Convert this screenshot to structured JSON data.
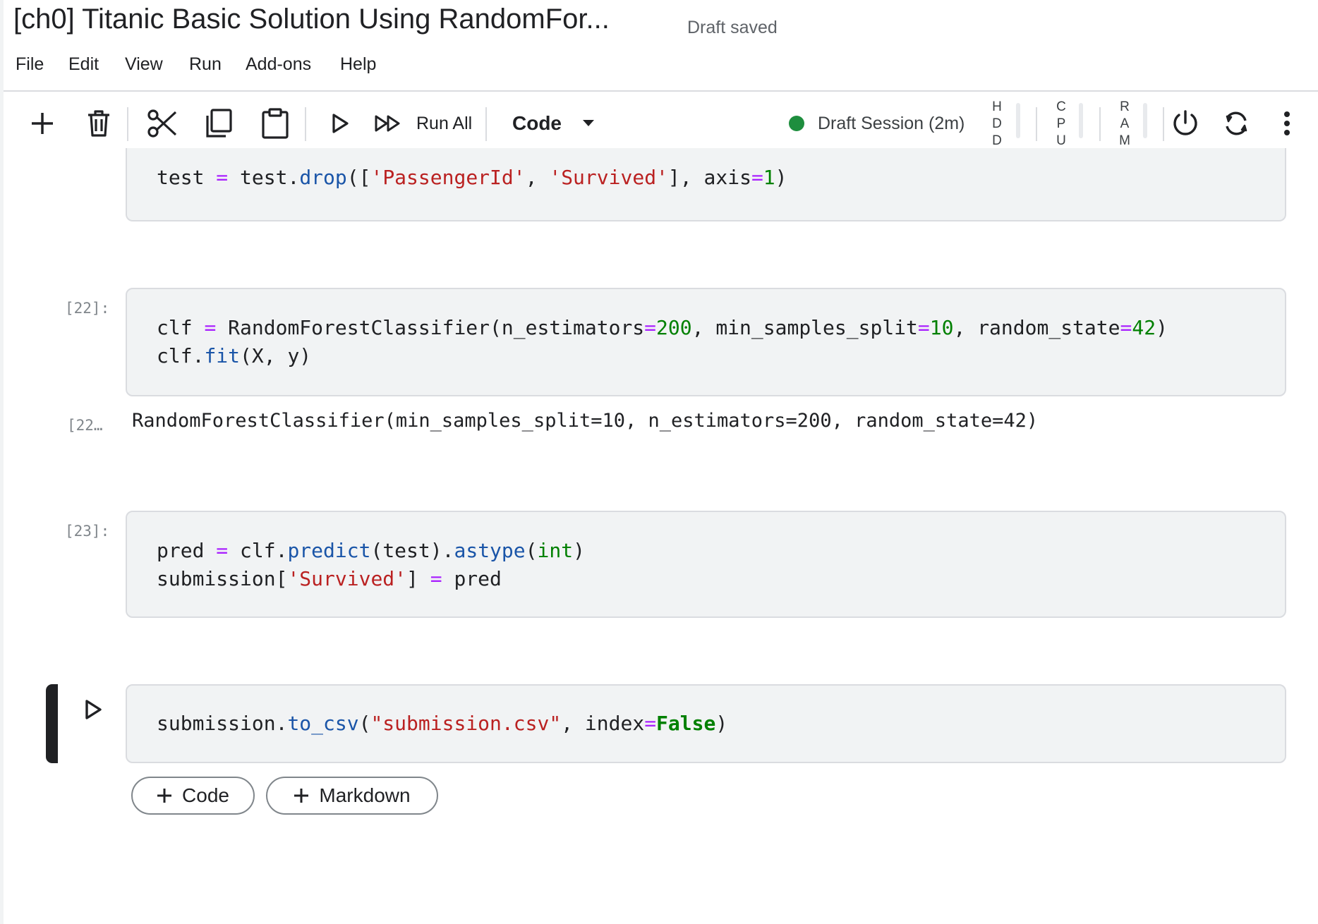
{
  "header": {
    "title": "[ch0] Titanic Basic Solution Using RandomFor...",
    "save_status": "Draft saved"
  },
  "menu": {
    "items": [
      "File",
      "Edit",
      "View",
      "Run",
      "Add-ons",
      "Help"
    ]
  },
  "toolbar": {
    "icons": [
      "plus-icon",
      "trash-icon",
      "scissors-icon",
      "copy-icon",
      "clipboard-icon",
      "play-icon",
      "fast-forward-icon",
      "power-icon",
      "restart-icon",
      "more-vert-icon"
    ],
    "run_all_label": "Run All",
    "cell_type": "Code",
    "session_label": "Draft Session (2m)",
    "session_color": "#1e8e3e",
    "meters": [
      {
        "letters": [
          "H",
          "D",
          "D"
        ]
      },
      {
        "letters": [
          "C",
          "P",
          "U"
        ]
      },
      {
        "letters": [
          "R",
          "A",
          "M"
        ]
      }
    ]
  },
  "cells": [
    {
      "code": "test = test.drop(['PassengerId', 'Survived'], axis=1)"
    },
    {
      "prompt": "[22]:",
      "code_lines": [
        "clf = RandomForestClassifier(n_estimators=200, min_samples_split=10, random_state=42)",
        "clf.fit(X, y)"
      ],
      "output_prompt": "[22…",
      "output": "RandomForestClassifier(min_samples_split=10, n_estimators=200, random_state=42)"
    },
    {
      "prompt": "[23]:",
      "code_lines": [
        "pred = clf.predict(test).astype(int)",
        "submission['Survived'] = pred"
      ]
    },
    {
      "code": "submission.to_csv(\"submission.csv\", index=False)"
    }
  ],
  "add_buttons": {
    "code_label": "Code",
    "markdown_label": "Markdown"
  },
  "colors": {
    "operator": "#aa22ff",
    "function": "#1a55a8",
    "string": "#ba2121",
    "number": "#008000"
  }
}
